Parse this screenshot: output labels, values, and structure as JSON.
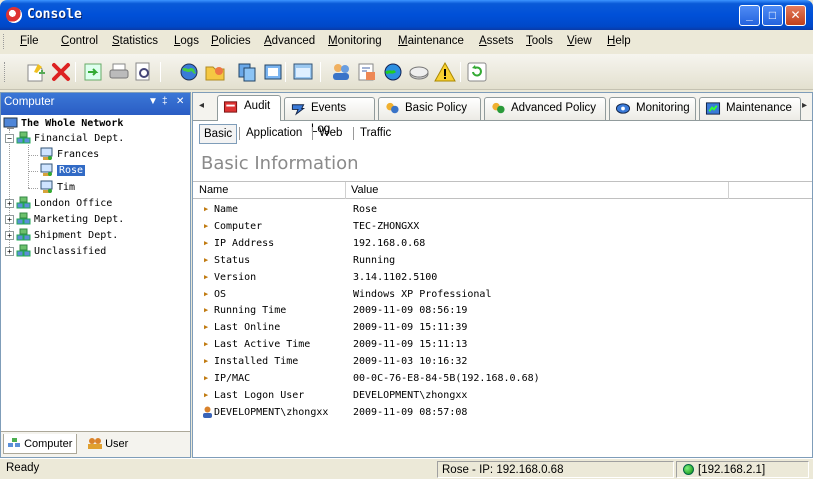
{
  "window": {
    "title": "Console"
  },
  "menu": [
    "File",
    "Control",
    "Statistics",
    "Logs",
    "Policies",
    "Advanced",
    "Monitoring",
    "Maintenance",
    "Assets",
    "Tools",
    "View",
    "Help"
  ],
  "menu_underline": [
    "F",
    "C",
    "S",
    "L",
    "P",
    "A",
    "M",
    "M",
    "A",
    "T",
    "V",
    "H"
  ],
  "toolbar_icons": [
    "new-icon",
    "delete-icon",
    "import-icon",
    "print-icon",
    "print-preview-icon",
    "globe-icon",
    "folder-icon",
    "copy-icon",
    "view-icon",
    "window-icon",
    "users-icon",
    "report-icon",
    "globe-network-icon",
    "disk-icon",
    "warning-icon",
    "refresh-icon"
  ],
  "left_pane": {
    "header": "Computer",
    "header_controls": [
      "▼",
      "‡",
      "✕"
    ],
    "tree": [
      {
        "label": "The Whole Network",
        "level": 0,
        "bold": true
      },
      {
        "label": "Financial Dept.",
        "level": 1,
        "expander": "−"
      },
      {
        "label": "Frances",
        "level": 2
      },
      {
        "label": "Rose",
        "level": 2,
        "selected": true
      },
      {
        "label": "Tim",
        "level": 2
      },
      {
        "label": "London Office",
        "level": 1,
        "expander": "+"
      },
      {
        "label": "Marketing Dept.",
        "level": 1,
        "expander": "+"
      },
      {
        "label": "Shipment Dept.",
        "level": 1,
        "expander": "+"
      },
      {
        "label": "Unclassified",
        "level": 1,
        "expander": "+"
      }
    ],
    "bottom_tabs": [
      "Computer",
      "User"
    ]
  },
  "right_pane": {
    "tabs": [
      "Audit",
      "Events Log",
      "Basic Policy",
      "Advanced Policy",
      "Monitoring",
      "Maintenance"
    ],
    "scroll_left": "◂",
    "scroll_right": "▸",
    "subtabs": [
      "Basic",
      "Application",
      "Web",
      "Traffic"
    ],
    "section_title": "Basic Information",
    "columns": [
      "Name",
      "Value"
    ],
    "rows": [
      {
        "name": "Name",
        "value": "Rose"
      },
      {
        "name": "Computer",
        "value": "TEC-ZHONGXX"
      },
      {
        "name": "IP Address",
        "value": "192.168.0.68"
      },
      {
        "name": "Status",
        "value": "Running"
      },
      {
        "name": "Version",
        "value": "3.14.1102.5100"
      },
      {
        "name": "OS",
        "value": "Windows XP Professional"
      },
      {
        "name": "Running Time",
        "value": "2009-11-09 08:56:19"
      },
      {
        "name": "Last Online",
        "value": "2009-11-09 15:11:39"
      },
      {
        "name": "Last Active Time",
        "value": "2009-11-09 15:11:13"
      },
      {
        "name": "Installed Time",
        "value": "2009-11-03 10:16:32"
      },
      {
        "name": "IP/MAC",
        "value": "00-0C-76-E8-84-5B(192.168.0.68)"
      },
      {
        "name": "Last Logon User",
        "value": "DEVELOPMENT\\zhongxx"
      },
      {
        "name": "DEVELOPMENT\\zhongxx",
        "value": "2009-11-09 08:57:08",
        "user_row": true
      }
    ]
  },
  "status": {
    "left": "Ready",
    "middle": "Rose - IP: 192.168.0.68",
    "right": "[192.168.2.1]"
  }
}
